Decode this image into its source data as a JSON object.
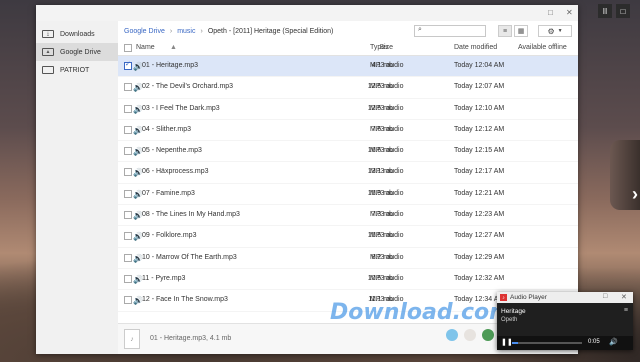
{
  "desktop": {
    "top_controls": [
      "II",
      "□"
    ],
    "next_arrow": "›"
  },
  "window": {
    "minimize": "_",
    "maximize": "□",
    "close": "✕"
  },
  "sidebar": {
    "items": [
      {
        "label": "Downloads",
        "icon": "download-icon",
        "active": false
      },
      {
        "label": "Google Drive",
        "icon": "drive-icon",
        "active": true
      },
      {
        "label": "PATRIOT",
        "icon": "usb-drive-icon",
        "active": false
      }
    ]
  },
  "breadcrumb": [
    "Google Drive",
    "music",
    "Opeth - [2011] Heritage (Special Edition)"
  ],
  "toolbar": {
    "search_placeholder": "",
    "list_view_icon": "list-view-icon",
    "grid_view_icon": "grid-view-icon",
    "settings_icon": "gear-icon"
  },
  "table": {
    "headers": {
      "name": "Name",
      "size": "Size",
      "type": "Types",
      "date": "Date modified",
      "offline": "Available offline"
    },
    "rows": [
      {
        "name": "01 - Heritage.mp3",
        "size": "4.1 mb",
        "type": "MP3 audio",
        "date": "Today 12:04 AM",
        "selected": true
      },
      {
        "name": "02 - The Devil's Orchard.mp3",
        "size": "12.5 mb",
        "type": "MP3 audio",
        "date": "Today 12:07 AM",
        "selected": false
      },
      {
        "name": "03 - I Feel The Dark.mp3",
        "size": "12.5 mb",
        "type": "MP3 audio",
        "date": "Today 12:10 AM",
        "selected": false
      },
      {
        "name": "04 - Slither.mp3",
        "size": "7.6 mb",
        "type": "MP3 audio",
        "date": "Today 12:12 AM",
        "selected": false
      },
      {
        "name": "05 - Nepenthe.mp3",
        "size": "16.6 mb",
        "type": "MP3 audio",
        "date": "Today 12:15 AM",
        "selected": false
      },
      {
        "name": "06 - Häxprocess.mp3",
        "size": "13.1 mb",
        "type": "MP3 audio",
        "date": "Today 12:17 AM",
        "selected": false
      },
      {
        "name": "07 - Famine.mp3",
        "size": "15.9 mb",
        "type": "MP3 audio",
        "date": "Today 12:21 AM",
        "selected": false
      },
      {
        "name": "08 - The Lines In My Hand.mp3",
        "size": "7.3 mb",
        "type": "MP3 audio",
        "date": "Today 12:23 AM",
        "selected": false
      },
      {
        "name": "09 - Folklore.mp3",
        "size": "15.5 mb",
        "type": "MP3 audio",
        "date": "Today 12:27 AM",
        "selected": false
      },
      {
        "name": "10 - Marrow Of The Earth.mp3",
        "size": "8.2 mb",
        "type": "MP3 audio",
        "date": "Today 12:29 AM",
        "selected": false
      },
      {
        "name": "11 - Pyre.mp3",
        "size": "10.5 mb",
        "type": "MP3 audio",
        "date": "Today 12:32 AM",
        "selected": false
      },
      {
        "name": "12 - Face In The Snow.mp3",
        "size": "11.1 mb",
        "type": "MP3 audio",
        "date": "Today 12:34 AM",
        "selected": false
      }
    ]
  },
  "footer": {
    "selection_text": "01 - Heritage.mp3, 4.1 mb"
  },
  "player": {
    "title": "Audio Player",
    "track": "Heritage",
    "artist": "Opeth",
    "time": "0:05",
    "progress": 0.08
  },
  "watermark": "Download.com.vn",
  "colors": {
    "accent": "#3a68c4",
    "selected_row": "#dce6f8",
    "audio_icon": "#dd3333"
  }
}
